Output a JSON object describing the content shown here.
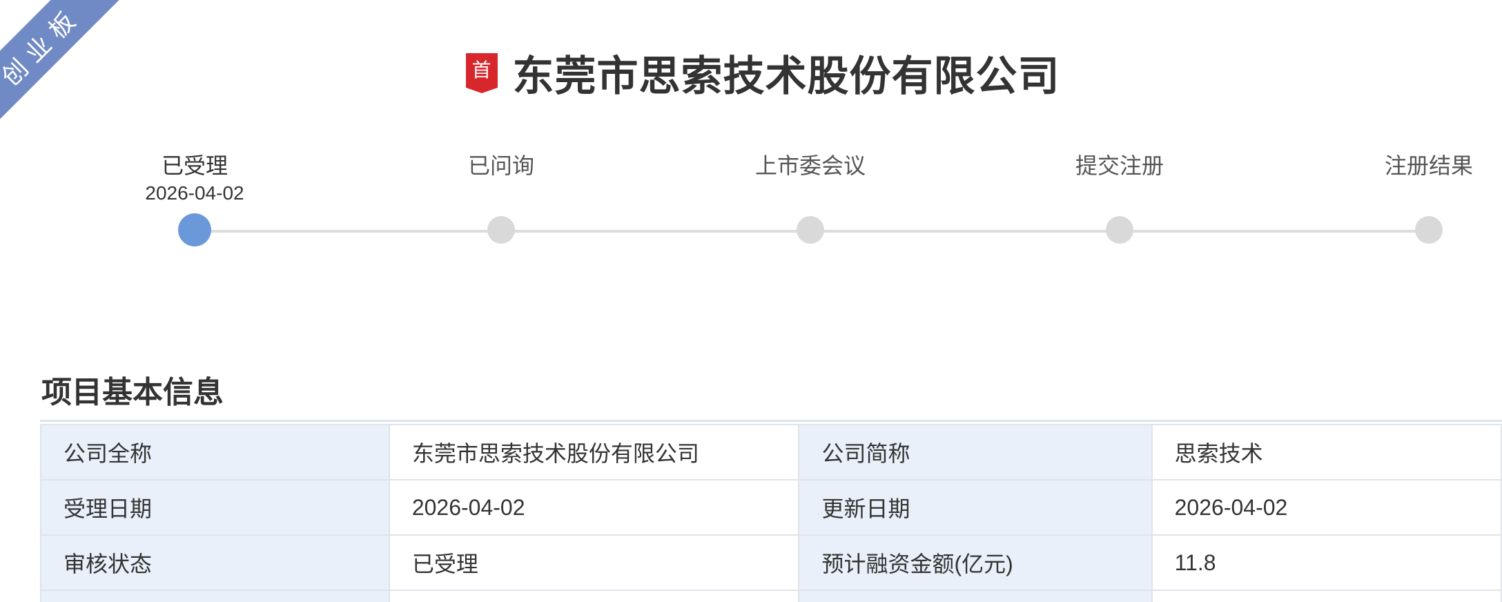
{
  "board_ribbon": "创业板",
  "header": {
    "badge_text": "首",
    "company_name": "东莞市思索技术股份有限公司"
  },
  "timeline": {
    "steps": [
      {
        "label": "已受理",
        "date": "2026-04-02",
        "active": true
      },
      {
        "label": "已问询",
        "date": "",
        "active": false
      },
      {
        "label": "上市委会议",
        "date": "",
        "active": false
      },
      {
        "label": "提交注册",
        "date": "",
        "active": false
      },
      {
        "label": "注册结果",
        "date": "",
        "active": false
      }
    ]
  },
  "section": {
    "title": "项目基本信息"
  },
  "info_table": {
    "rows": [
      {
        "k1": "公司全称",
        "v1": "东莞市思索技术股份有限公司",
        "k2": "公司简称",
        "v2": "思索技术"
      },
      {
        "k1": "受理日期",
        "v1": "2026-04-02",
        "k2": "更新日期",
        "v2": "2026-04-02"
      },
      {
        "k1": "审核状态",
        "v1": "已受理",
        "k2": "预计融资金额(亿元)",
        "v2": "11.8"
      }
    ]
  },
  "colors": {
    "ribbon": "#6f8ac4",
    "badge": "#d8262d",
    "active_dot": "#6a98d8",
    "inactive_dot": "#d9d9d9",
    "key_cell_bg": "#e9f0f9"
  }
}
